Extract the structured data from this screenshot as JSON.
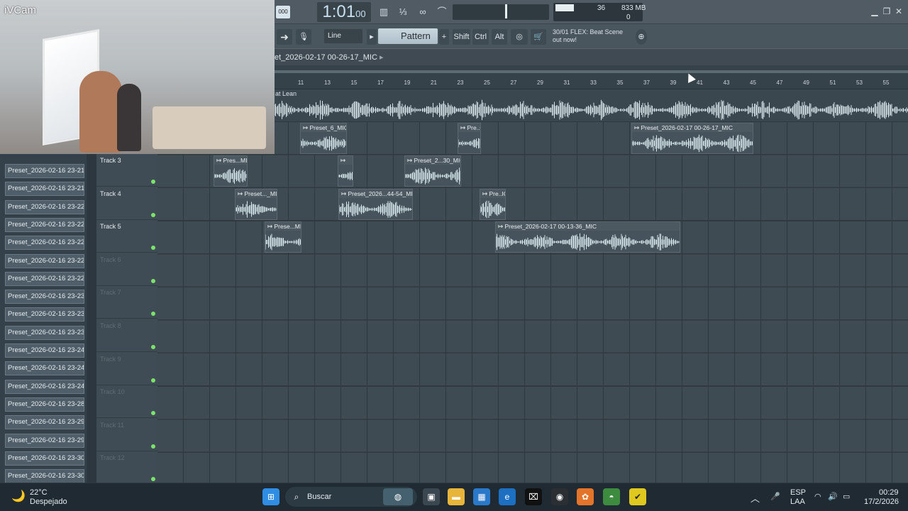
{
  "webcam": {
    "label": "iVCam"
  },
  "transport": {
    "lcd": "000",
    "time": "1:01",
    "time_sub": "00",
    "cpu_value": "36",
    "memory": "833 MB",
    "memory_sub": "0"
  },
  "toolbar2": {
    "snap": "Line",
    "pattern": "Pattern 1",
    "shift": "Shift",
    "ctrl": "Ctrl",
    "alt": "Alt",
    "hint_line1": "30/01  FLEX: Beat Scene",
    "hint_line2": "out now!"
  },
  "playlist": {
    "title": "et_2026-02-17 00-26-17_MIC",
    "top_track_label": "at Lean",
    "ruler": [
      "11",
      "13",
      "15",
      "17",
      "19",
      "21",
      "23",
      "25",
      "27",
      "29",
      "31",
      "33",
      "35",
      "37",
      "39",
      "41",
      "43",
      "45",
      "47",
      "49",
      "51",
      "53",
      "55"
    ]
  },
  "left_clips": [
    "Preset_2026-02-16 23-21...",
    "Preset_2026-02-16 23-21...",
    "Preset_2026-02-16 23-22...",
    "Preset_2026-02-16 23-22...",
    "Preset_2026-02-16 23-22...",
    "Preset_2026-02-16 23-22...",
    "Preset_2026-02-16 23-22...",
    "Preset_2026-02-16 23-23...",
    "Preset_2026-02-16 23-23...",
    "Preset_2026-02-16 23-23...",
    "Preset_2026-02-16 23-24...",
    "Preset_2026-02-16 23-24...",
    "Preset_2026-02-16 23-24...",
    "Preset_2026-02-16 23-28...",
    "Preset_2026-02-16 23-29...",
    "Preset_2026-02-16 23-29...",
    "Preset_2026-02-16 23-30...",
    "Preset_2026-02-16 23-30..."
  ],
  "tracks": [
    "Track 3",
    "Track 4",
    "Track 5",
    "Track 6",
    "Track 7",
    "Track 8",
    "Track 9",
    "Track 10",
    "Track 11",
    "Track 12"
  ],
  "clips": {
    "c1": "Preset_6_MIC",
    "c2": "Pre..C",
    "c3": "Preset_2026-02-17 00-26-17_MIC",
    "c4": "Pres...MIC",
    "c5": "",
    "c6": "Preset_2...30_MIC",
    "c7": "Preset..._MIC",
    "c8": "Preset_2026...44-54_MIC",
    "c9": "Pre..IC",
    "c10": "Prese...MIC",
    "c11": "Preset_2026-02-17 00-13-36_MIC"
  },
  "taskbar": {
    "temp": "22°C",
    "weather": "Despejado",
    "search": "Buscar",
    "lang1": "ESP",
    "lang2": "LAA",
    "time": "00:29",
    "date": "17/2/2026"
  }
}
